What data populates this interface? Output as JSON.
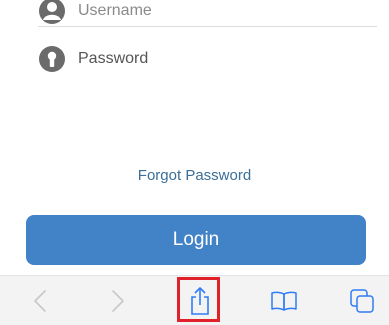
{
  "form": {
    "username_label": "Username",
    "password_label": "Password",
    "username_icon": "user-icon",
    "password_icon": "lock-icon"
  },
  "links": {
    "forgot_password": "Forgot Password"
  },
  "buttons": {
    "login": "Login"
  },
  "toolbar": {
    "items": [
      {
        "name": "back",
        "icon": "chevron-left-icon"
      },
      {
        "name": "forward",
        "icon": "chevron-right-icon"
      },
      {
        "name": "share",
        "icon": "share-icon",
        "highlighted": true
      },
      {
        "name": "bookmarks",
        "icon": "book-icon"
      },
      {
        "name": "tabs",
        "icon": "tabs-icon"
      }
    ]
  },
  "colors": {
    "login_button": "#4283c7",
    "link": "#3b6e99",
    "toolbar_icon": "#2f7cf6",
    "highlight": "#e0202a"
  }
}
